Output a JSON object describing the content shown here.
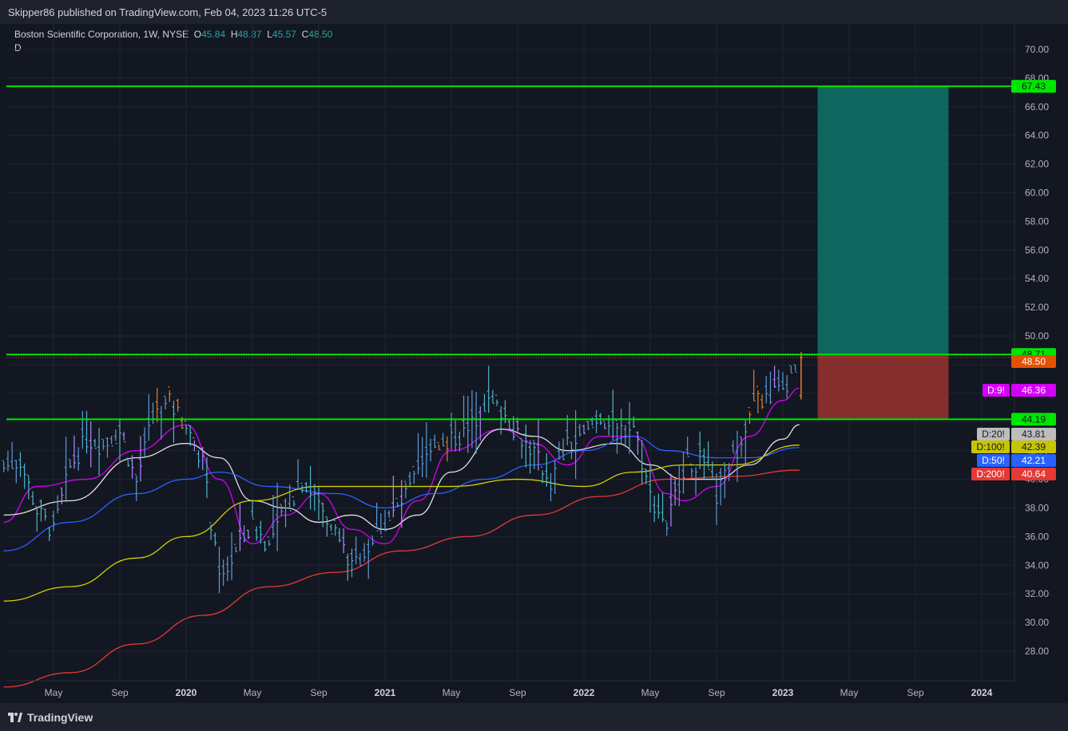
{
  "header": {
    "published": "Skipper86 published on TradingView.com, Feb 04, 2023 11:26 UTC-5"
  },
  "legend": {
    "name": "Boston Scientific Corporation, 1W, NYSE",
    "o_label": "O",
    "o": "45.84",
    "h_label": "H",
    "h": "48.87",
    "l_label": "L",
    "l": "45.57",
    "c_label": "C",
    "c": "48.50",
    "sub": "D"
  },
  "footer": {
    "brand": "TradingView"
  },
  "colors": {
    "up": "#5b9bd5",
    "down": "#4fb6c9",
    "accent_orange": "#e67e22",
    "purple": "#b388ff",
    "ma9": "#d500f9",
    "ma20": "#e0e0e0",
    "ma50": "#2962ff",
    "ma100": "#d4d000",
    "ma200": "#e53935",
    "level": "#00e500",
    "target": "#0e6b63",
    "stop": "#8b2f2f"
  },
  "chart_data": {
    "type": "line",
    "title": "Boston Scientific Corporation, 1W, NYSE",
    "ylim": [
      26,
      71.5
    ],
    "y_ticks": [
      "28.00",
      "30.00",
      "32.00",
      "34.00",
      "36.00",
      "38.00",
      "40.00",
      "42.00",
      "44.00",
      "46.00",
      "48.00",
      "50.00",
      "52.00",
      "54.00",
      "56.00",
      "58.00",
      "60.00",
      "62.00",
      "64.00",
      "66.00",
      "68.00",
      "70.00"
    ],
    "x_ticks": [
      {
        "label": "May",
        "date": "2019-05",
        "year": false
      },
      {
        "label": "Sep",
        "date": "2019-09",
        "year": false
      },
      {
        "label": "2020",
        "date": "2020-01",
        "year": true
      },
      {
        "label": "May",
        "date": "2020-05",
        "year": false
      },
      {
        "label": "Sep",
        "date": "2020-09",
        "year": false
      },
      {
        "label": "2021",
        "date": "2021-01",
        "year": true
      },
      {
        "label": "May",
        "date": "2021-05",
        "year": false
      },
      {
        "label": "Sep",
        "date": "2021-09",
        "year": false
      },
      {
        "label": "2022",
        "date": "2022-01",
        "year": true
      },
      {
        "label": "May",
        "date": "2022-05",
        "year": false
      },
      {
        "label": "Sep",
        "date": "2022-09",
        "year": false
      },
      {
        "label": "2023",
        "date": "2023-01",
        "year": true
      },
      {
        "label": "May",
        "date": "2023-05",
        "year": false
      },
      {
        "label": "Sep",
        "date": "2023-09",
        "year": false
      },
      {
        "label": "2024",
        "date": "2024-01",
        "year": true
      }
    ],
    "price_path": [
      [
        "2019-02",
        41.0
      ],
      [
        "2019-03",
        41.5
      ],
      [
        "2019-04",
        38.0
      ],
      [
        "2019-05",
        36.5
      ],
      [
        "2019-06",
        41.0
      ],
      [
        "2019-07",
        43.0
      ],
      [
        "2019-08",
        42.5
      ],
      [
        "2019-09",
        43.5
      ],
      [
        "2019-10",
        40.0
      ],
      [
        "2019-11",
        44.5
      ],
      [
        "2019-12",
        45.5
      ],
      [
        "2020-01",
        44.0
      ],
      [
        "2020-02",
        41.5
      ],
      [
        "2020-03",
        33.0
      ],
      [
        "2020-04",
        35.0
      ],
      [
        "2020-05",
        37.0
      ],
      [
        "2020-06",
        35.5
      ],
      [
        "2020-07",
        38.0
      ],
      [
        "2020-08",
        40.0
      ],
      [
        "2020-09",
        38.5
      ],
      [
        "2020-10",
        36.5
      ],
      [
        "2020-11",
        34.0
      ],
      [
        "2020-12",
        35.5
      ],
      [
        "2021-01",
        37.0
      ],
      [
        "2021-02",
        38.5
      ],
      [
        "2021-03",
        40.5
      ],
      [
        "2021-04",
        42.5
      ],
      [
        "2021-05",
        43.0
      ],
      [
        "2021-06",
        43.5
      ],
      [
        "2021-07",
        45.5
      ],
      [
        "2021-08",
        45.0
      ],
      [
        "2021-09",
        43.5
      ],
      [
        "2021-10",
        42.0
      ],
      [
        "2021-11",
        40.0
      ],
      [
        "2021-12",
        42.5
      ],
      [
        "2022-01",
        43.0
      ],
      [
        "2022-02",
        44.5
      ],
      [
        "2022-03",
        43.5
      ],
      [
        "2022-04",
        44.0
      ],
      [
        "2022-05",
        39.0
      ],
      [
        "2022-06",
        37.0
      ],
      [
        "2022-07",
        41.0
      ],
      [
        "2022-08",
        41.5
      ],
      [
        "2022-09",
        39.0
      ],
      [
        "2022-10",
        41.5
      ],
      [
        "2022-11",
        45.0
      ],
      [
        "2022-12",
        46.0
      ],
      [
        "2023-01",
        46.5
      ],
      [
        "2023-02",
        48.5
      ]
    ],
    "series": [
      {
        "name": "D:9!",
        "color": "#d500f9",
        "last": 46.36,
        "values": [
          [
            "2019-02",
            37.0
          ],
          [
            "2019-04",
            39.5
          ],
          [
            "2019-07",
            40.0
          ],
          [
            "2019-10",
            42.0
          ],
          [
            "2020-01",
            43.8
          ],
          [
            "2020-03",
            40.0
          ],
          [
            "2020-05",
            35.5
          ],
          [
            "2020-07",
            37.5
          ],
          [
            "2020-09",
            39.0
          ],
          [
            "2020-11",
            36.5
          ],
          [
            "2021-01",
            35.5
          ],
          [
            "2021-03",
            38.5
          ],
          [
            "2021-05",
            42.0
          ],
          [
            "2021-08",
            43.5
          ],
          [
            "2021-10",
            42.5
          ],
          [
            "2021-12",
            41.0
          ],
          [
            "2022-02",
            43.0
          ],
          [
            "2022-04",
            43.0
          ],
          [
            "2022-06",
            39.0
          ],
          [
            "2022-07",
            38.5
          ],
          [
            "2022-09",
            39.5
          ],
          [
            "2022-11",
            43.0
          ],
          [
            "2023-01",
            45.5
          ],
          [
            "2023-02",
            46.36
          ]
        ]
      },
      {
        "name": "D:20!",
        "color": "#e0e0e0",
        "last": 43.81,
        "values": [
          [
            "2019-02",
            37.5
          ],
          [
            "2019-06",
            38.5
          ],
          [
            "2019-10",
            41.5
          ],
          [
            "2020-01",
            42.5
          ],
          [
            "2020-03",
            41.5
          ],
          [
            "2020-05",
            38.5
          ],
          [
            "2020-07",
            38.0
          ],
          [
            "2020-09",
            37.0
          ],
          [
            "2020-11",
            37.5
          ],
          [
            "2021-01",
            36.5
          ],
          [
            "2021-03",
            37.5
          ],
          [
            "2021-05",
            40.5
          ],
          [
            "2021-08",
            43.5
          ],
          [
            "2021-10",
            43.0
          ],
          [
            "2021-12",
            42.0
          ],
          [
            "2022-03",
            42.5
          ],
          [
            "2022-05",
            41.0
          ],
          [
            "2022-07",
            40.0
          ],
          [
            "2022-09",
            40.0
          ],
          [
            "2022-11",
            41.0
          ],
          [
            "2023-01",
            42.8
          ],
          [
            "2023-02",
            43.81
          ]
        ]
      },
      {
        "name": "D:50!",
        "color": "#2962ff",
        "last": 42.21,
        "values": [
          [
            "2019-02",
            35.0
          ],
          [
            "2019-06",
            37.0
          ],
          [
            "2019-10",
            39.0
          ],
          [
            "2020-01",
            40.0
          ],
          [
            "2020-03",
            40.5
          ],
          [
            "2020-06",
            39.5
          ],
          [
            "2020-10",
            39.0
          ],
          [
            "2021-01",
            38.0
          ],
          [
            "2021-04",
            39.0
          ],
          [
            "2021-07",
            40.0
          ],
          [
            "2021-10",
            41.0
          ],
          [
            "2022-01",
            42.0
          ],
          [
            "2022-04",
            43.0
          ],
          [
            "2022-06",
            42.0
          ],
          [
            "2022-09",
            41.5
          ],
          [
            "2022-11",
            41.5
          ],
          [
            "2023-02",
            42.21
          ]
        ]
      },
      {
        "name": "D:100!",
        "color": "#d4d000",
        "last": 42.39,
        "values": [
          [
            "2019-02",
            31.5
          ],
          [
            "2019-06",
            32.5
          ],
          [
            "2019-10",
            34.5
          ],
          [
            "2020-01",
            36.0
          ],
          [
            "2020-05",
            38.5
          ],
          [
            "2020-09",
            39.5
          ],
          [
            "2021-01",
            39.5
          ],
          [
            "2021-05",
            39.5
          ],
          [
            "2021-09",
            40.0
          ],
          [
            "2022-01",
            39.5
          ],
          [
            "2022-04",
            40.5
          ],
          [
            "2022-07",
            41.0
          ],
          [
            "2022-10",
            41.0
          ],
          [
            "2023-02",
            42.39
          ]
        ]
      },
      {
        "name": "D:200!",
        "color": "#e53935",
        "last": 40.64,
        "values": [
          [
            "2019-02",
            25.5
          ],
          [
            "2019-06",
            26.5
          ],
          [
            "2019-10",
            28.5
          ],
          [
            "2020-02",
            30.5
          ],
          [
            "2020-06",
            32.5
          ],
          [
            "2020-10",
            33.5
          ],
          [
            "2021-02",
            35.0
          ],
          [
            "2021-06",
            36.0
          ],
          [
            "2021-10",
            37.5
          ],
          [
            "2022-02",
            38.8
          ],
          [
            "2022-06",
            40.0
          ],
          [
            "2022-10",
            40.2
          ],
          [
            "2023-02",
            40.64
          ]
        ]
      }
    ],
    "levels": [
      {
        "value": 67.43,
        "label": "67.43",
        "color": "#00e500"
      },
      {
        "value": 48.71,
        "label": "48.71",
        "color": "#00e500"
      },
      {
        "value": 44.19,
        "label": "44.19",
        "color": "#00e500"
      }
    ],
    "last_price": {
      "value": 48.5,
      "label": "48.50",
      "color": "#e65100"
    },
    "position": {
      "entry": 48.71,
      "target": 67.43,
      "stop": 44.19,
      "from": "2023-03-04",
      "to": "2023-11-01"
    },
    "ma_tags": [
      {
        "name": "D:9!",
        "value": "46.36",
        "color": "#d500f9",
        "text": "#ffffff"
      },
      {
        "name": "D:20!",
        "value": "43.81",
        "color": "#bdbdbd",
        "text": "#131722"
      },
      {
        "name": "D:100!",
        "value": "42.39",
        "color": "#c8c400",
        "text": "#131722"
      },
      {
        "name": "D:50!",
        "value": "42.21",
        "color": "#2962ff",
        "text": "#ffffff"
      },
      {
        "name": "D:200!",
        "value": "40.64",
        "color": "#e53935",
        "text": "#ffffff"
      }
    ]
  }
}
